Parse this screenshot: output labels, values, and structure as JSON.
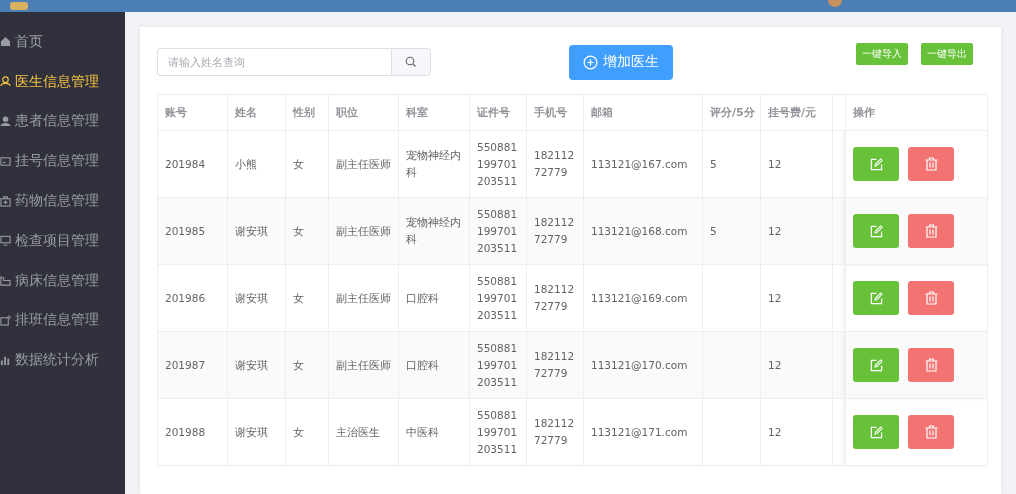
{
  "sidebar": {
    "items": [
      {
        "label": "首页",
        "selected": false
      },
      {
        "label": "医生信息管理",
        "selected": true
      },
      {
        "label": "患者信息管理",
        "selected": false
      },
      {
        "label": "挂号信息管理",
        "selected": false
      },
      {
        "label": "药物信息管理",
        "selected": false
      },
      {
        "label": "检查项目管理",
        "selected": false
      },
      {
        "label": "病床信息管理",
        "selected": false
      },
      {
        "label": "排班信息管理",
        "selected": false
      },
      {
        "label": "数据统计分析",
        "selected": false
      }
    ]
  },
  "toolbar": {
    "search": {
      "placeholder": "请输入姓名查询"
    },
    "add_button": "增加医生",
    "import_button": "一键导入",
    "export_button": "一键导出"
  },
  "table": {
    "columns": [
      "账号",
      "姓名",
      "性别",
      "职位",
      "科室",
      "证件号",
      "手机号",
      "邮箱",
      "评分/5分",
      "挂号费/元",
      "",
      "操作"
    ],
    "rows": [
      {
        "cells": [
          "201984",
          "小熊",
          "女",
          "副主任医师",
          "宠物神经内科",
          "550881199701203511",
          "18211272779",
          "113121@167.com",
          "5",
          "12",
          ""
        ]
      },
      {
        "cells": [
          "201985",
          "谢安琪",
          "女",
          "副主任医师",
          "宠物神经内科",
          "550881199701203511",
          "18211272779",
          "113121@168.com",
          "5",
          "12",
          ""
        ]
      },
      {
        "cells": [
          "201986",
          "谢安琪",
          "女",
          "副主任医师",
          "口腔科",
          "550881199701203511",
          "18211272779",
          "113121@169.com",
          "",
          "12",
          ""
        ]
      },
      {
        "cells": [
          "201987",
          "谢安琪",
          "女",
          "副主任医师",
          "口腔科",
          "550881199701203511",
          "18211272779",
          "113121@170.com",
          "",
          "12",
          ""
        ]
      },
      {
        "cells": [
          "201988",
          "谢安琪",
          "女",
          "主治医生",
          "中医科",
          "550881199701203511",
          "18211272779",
          "113121@171.com",
          "",
          "12",
          ""
        ]
      }
    ]
  }
}
